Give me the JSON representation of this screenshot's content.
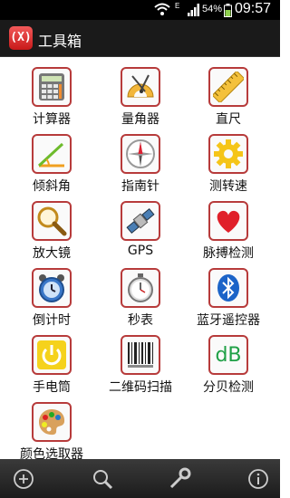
{
  "status_bar": {
    "network": "E",
    "battery": "54%",
    "time": "09:57"
  },
  "app": {
    "title": "工具箱",
    "logo_text": "(X)"
  },
  "tools": [
    {
      "label": "计算器",
      "icon": "calculator-icon"
    },
    {
      "label": "量角器",
      "icon": "protractor-icon"
    },
    {
      "label": "直尺",
      "icon": "ruler-icon"
    },
    {
      "label": "倾斜角",
      "icon": "tilt-angle-icon"
    },
    {
      "label": "指南针",
      "icon": "compass-icon"
    },
    {
      "label": "测转速",
      "icon": "gear-icon"
    },
    {
      "label": "放大镜",
      "icon": "magnifier-icon"
    },
    {
      "label": "GPS",
      "icon": "satellite-icon"
    },
    {
      "label": "脉搏检测",
      "icon": "heart-icon"
    },
    {
      "label": "倒计时",
      "icon": "alarm-clock-icon"
    },
    {
      "label": "秒表",
      "icon": "stopwatch-icon"
    },
    {
      "label": "蓝牙遥控器",
      "icon": "bluetooth-icon"
    },
    {
      "label": "手电筒",
      "icon": "power-icon"
    },
    {
      "label": "二维码扫描",
      "icon": "barcode-icon"
    },
    {
      "label": "分贝检测",
      "icon": "decibel-icon",
      "icon_text": "dB"
    },
    {
      "label": "颜色选取器",
      "icon": "palette-icon"
    }
  ],
  "bottom_bar": [
    "add-icon",
    "search-icon",
    "wrench-icon",
    "info-icon"
  ]
}
